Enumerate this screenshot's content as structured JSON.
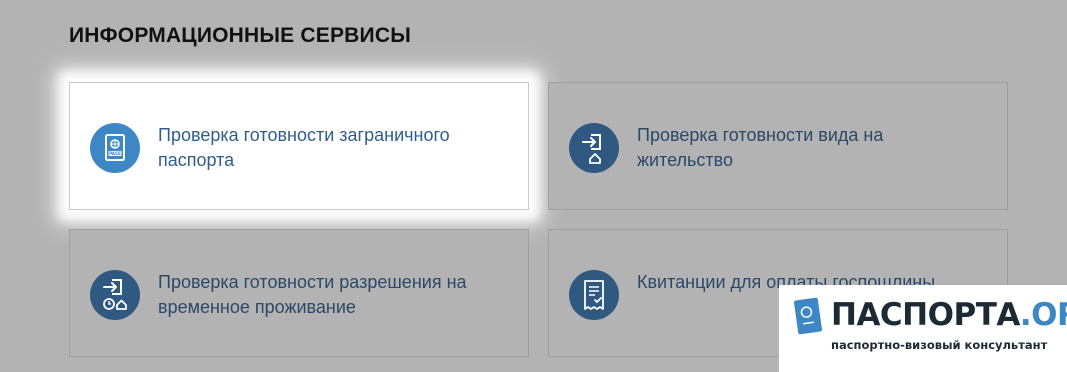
{
  "section": {
    "title": "ИНФОРМАЦИОННЫЕ СЕРВИСЫ"
  },
  "services": [
    {
      "label": "Проверка готовности заграничного паспорта",
      "icon": "passport-icon",
      "highlighted": true
    },
    {
      "label": "Проверка готовности вида на жительство",
      "icon": "residence-permit-icon",
      "highlighted": false
    },
    {
      "label": "Проверка готовности разрешения на временное проживание",
      "icon": "temporary-residence-icon",
      "highlighted": false
    },
    {
      "label": "Квитанции для оплаты госпошлины",
      "icon": "receipt-icon",
      "highlighted": false
    }
  ],
  "watermark": {
    "logo_main": "ПАСПОРТА",
    "logo_suffix": ".ORG",
    "tagline": "паспортно-визовый консультант",
    "icon": "passport-logo-icon"
  },
  "colors": {
    "background": "#b3b3b3",
    "card_highlight_bg": "#ffffff",
    "icon_dark": "#2f5980",
    "icon_active": "#3d87c5",
    "text_link": "#2a4868",
    "title_text": "#111111"
  }
}
